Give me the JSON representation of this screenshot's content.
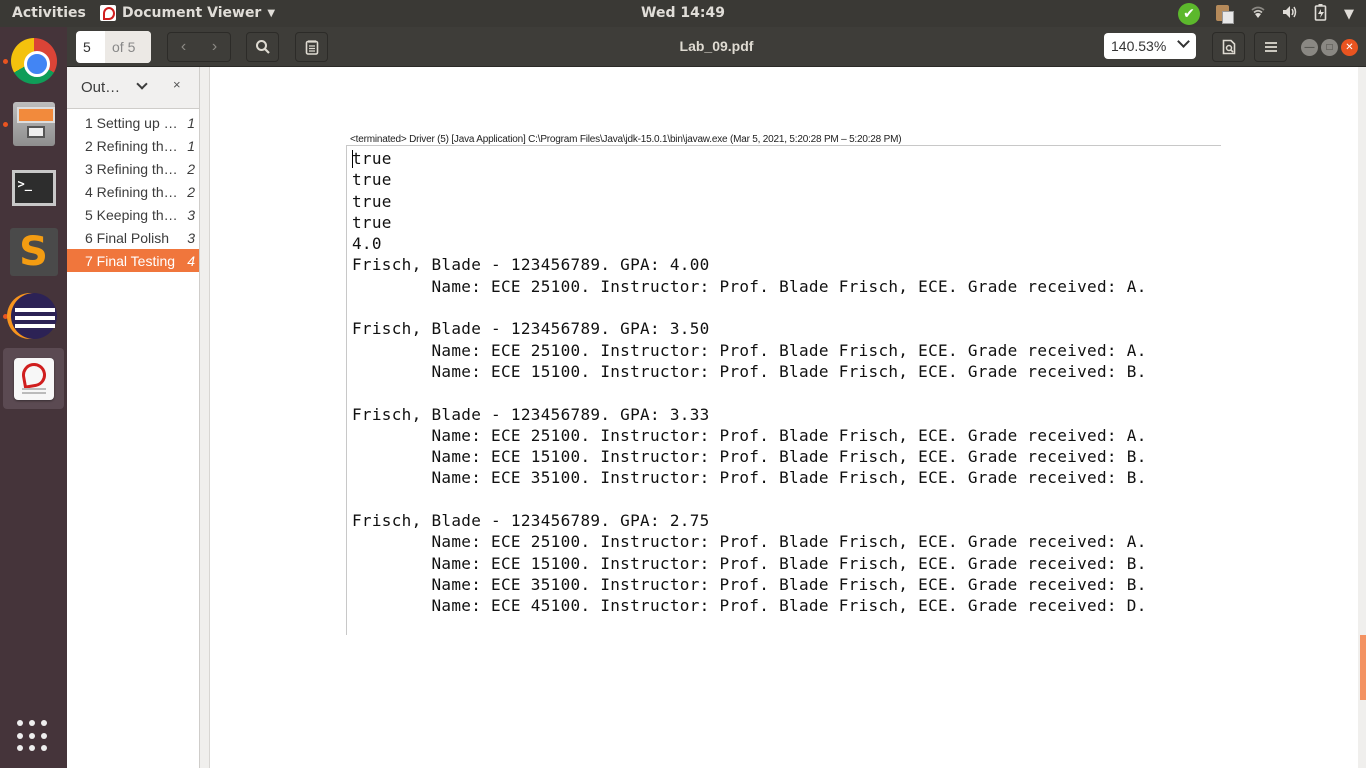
{
  "topbar": {
    "activities": "Activities",
    "app_name": "Document Viewer",
    "clock": "Wed 14:49"
  },
  "dock": {
    "apps": [
      "Google Chrome",
      "Files",
      "Terminal",
      "Sublime Text",
      "Eclipse",
      "Document Viewer"
    ],
    "terminal_glyph": ">_",
    "sublime_glyph": "S"
  },
  "toolbar": {
    "page_current": "5",
    "page_total": "of 5",
    "document_title": "Lab_09.pdf",
    "zoom_level": "140.53%"
  },
  "sidebar": {
    "mode_label": "Out…",
    "close_glyph": "×",
    "outline": [
      {
        "label": "1 Setting up …",
        "page": "1"
      },
      {
        "label": "2 Refining th…",
        "page": "1"
      },
      {
        "label": "3 Refining th…",
        "page": "2"
      },
      {
        "label": "4 Refining th…",
        "page": "2"
      },
      {
        "label": "5 Keeping th…",
        "page": "3"
      },
      {
        "label": "6 Final Polish",
        "page": "3"
      },
      {
        "label": "7 Final Testing",
        "page": "4"
      }
    ],
    "selected_index": 6
  },
  "document": {
    "console_header": "<terminated> Driver (5) [Java Application] C:\\Program Files\\Java\\jdk-15.0.1\\bin\\javaw.exe  (Mar 5, 2021, 5:20:28 PM – 5:20:28 PM)",
    "console_lines": [
      "true",
      "true",
      "true",
      "true",
      "4.0",
      "Frisch, Blade - 123456789. GPA: 4.00",
      "        Name: ECE 25100. Instructor: Prof. Blade Frisch, ECE. Grade received: A.",
      "",
      "Frisch, Blade - 123456789. GPA: 3.50",
      "        Name: ECE 25100. Instructor: Prof. Blade Frisch, ECE. Grade received: A.",
      "        Name: ECE 15100. Instructor: Prof. Blade Frisch, ECE. Grade received: B.",
      "",
      "Frisch, Blade - 123456789. GPA: 3.33",
      "        Name: ECE 25100. Instructor: Prof. Blade Frisch, ECE. Grade received: A.",
      "        Name: ECE 15100. Instructor: Prof. Blade Frisch, ECE. Grade received: B.",
      "        Name: ECE 35100. Instructor: Prof. Blade Frisch, ECE. Grade received: B.",
      "",
      "Frisch, Blade - 123456789. GPA: 2.75",
      "        Name: ECE 25100. Instructor: Prof. Blade Frisch, ECE. Grade received: A.",
      "        Name: ECE 15100. Instructor: Prof. Blade Frisch, ECE. Grade received: B.",
      "        Name: ECE 35100. Instructor: Prof. Blade Frisch, ECE. Grade received: B.",
      "        Name: ECE 45100. Instructor: Prof. Blade Frisch, ECE. Grade received: D."
    ]
  },
  "colors": {
    "accent": "#f0763c",
    "dock_bg": "#45343a",
    "headerbar_bg": "#3e3d39",
    "close_button": "#e95420"
  }
}
